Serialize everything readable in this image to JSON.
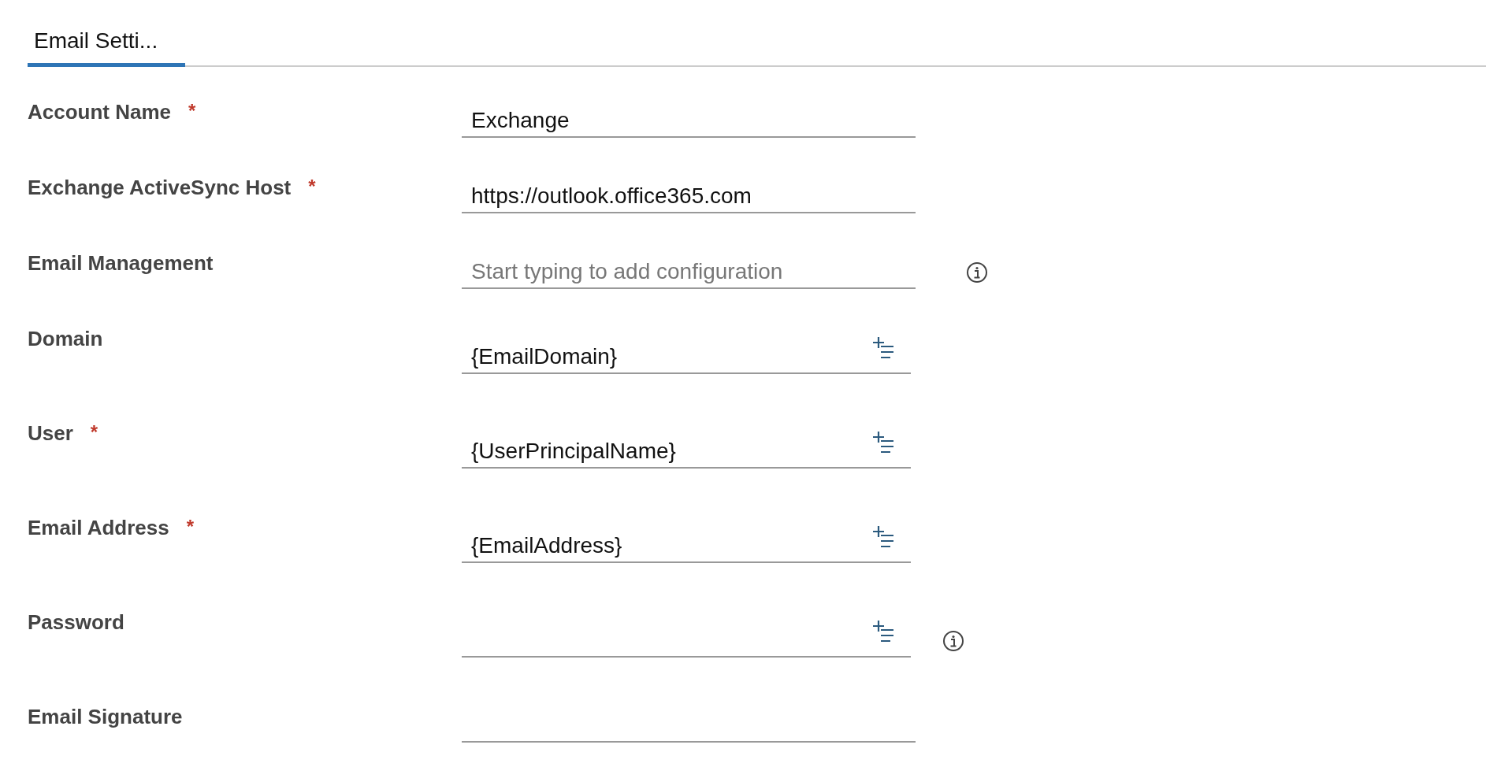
{
  "tabs": [
    {
      "label": "Email Setti...",
      "selected": true
    }
  ],
  "fields": [
    {
      "kind": "text",
      "label": "Account Name",
      "required_mark": "*",
      "value": "Exchange"
    },
    {
      "kind": "text",
      "label": "Exchange ActiveSync Host",
      "required_mark": "*",
      "value": "https://outlook.office365.com"
    },
    {
      "kind": "text",
      "label": "Email Management",
      "placeholder": "Start typing to add configuration",
      "info": true
    },
    {
      "kind": "lookup",
      "label": "Domain",
      "value": "{EmailDomain}"
    },
    {
      "kind": "lookup",
      "label": "User",
      "required_mark": "*",
      "value": "{UserPrincipalName}"
    },
    {
      "kind": "lookup",
      "label": "Email Address",
      "required_mark": "*",
      "value": "{EmailAddress}"
    },
    {
      "kind": "lookup",
      "label": "Password",
      "info": true
    },
    {
      "kind": "text",
      "label": "Email Signature"
    }
  ]
}
